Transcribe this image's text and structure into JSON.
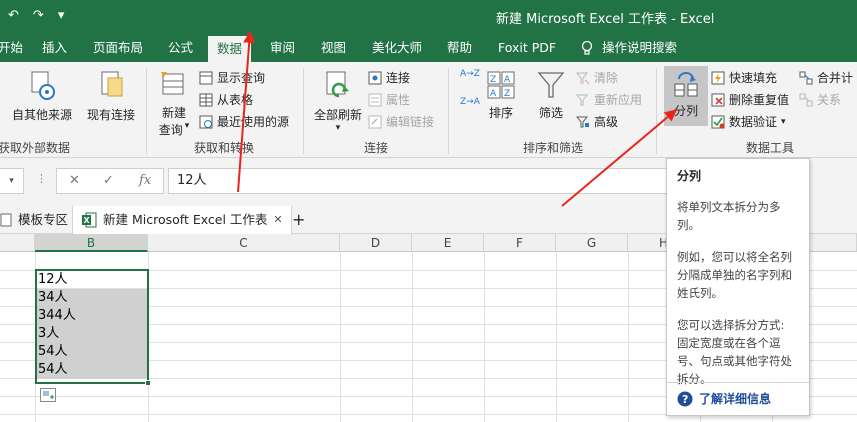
{
  "window": {
    "title": "新建 Microsoft Excel 工作表  -  Excel",
    "qat": [
      "↶",
      "↷",
      "▾"
    ]
  },
  "tabs": [
    "开始",
    "插入",
    "页面布局",
    "公式",
    "数据",
    "审阅",
    "视图",
    "美化大师",
    "帮助",
    "Foxit PDF",
    "操作说明搜索"
  ],
  "ribbon": {
    "get_external": {
      "label": "自其他来源",
      "group": "获取外部数据"
    },
    "existing": {
      "label": "现有连接"
    },
    "new_query": {
      "label_1": "新建",
      "label_2": "查询",
      "caret": "▾"
    },
    "show_query": "显示查询",
    "from_table": "从表格",
    "recent_sources": "最近使用的源",
    "group_get_transform": "获取和转换",
    "refresh_all": {
      "label": "全部刷新",
      "caret": "▾"
    },
    "connections": "连接",
    "properties": "属性",
    "edit_links": "编辑链接",
    "group_connections": "连接",
    "sort_asc": "A→Z",
    "sort_desc": "Z→A",
    "sort": "排序",
    "filter": "筛选",
    "clear": "清除",
    "reapply": "重新应用",
    "advanced": "高级",
    "group_sort_filter": "排序和筛选",
    "text_to_columns": "分列",
    "flash_fill": "快速填充",
    "remove_duplicates": "删除重复值",
    "data_validation": "数据验证",
    "validation_caret": "▾",
    "consolidate": "合并计",
    "relations": "关系",
    "group_data_tools": "数据工具"
  },
  "formula_bar": {
    "value": "12人",
    "cancel": "✕",
    "enter": "✓",
    "fx": "fx",
    "dots": "⋮",
    "caret": "▾"
  },
  "doc_tabs": [
    {
      "label": "模板专区"
    },
    {
      "label": "新建 Microsoft Excel 工作表",
      "close": "✕"
    }
  ],
  "add_tab": "+",
  "columns": [
    "B",
    "C",
    "D",
    "E",
    "F",
    "G",
    "H"
  ],
  "cells": [
    "12人",
    "34人",
    "344人",
    "3人",
    "54人",
    "54人"
  ],
  "tooltip": {
    "title": "分列",
    "p1": "将单列文本拆分为多列。",
    "p2": "例如，您可以将全名列分隔成单独的名字列和姓氏列。",
    "p3": "您可以选择拆分方式: 固定宽度或在各个逗号、句点或其他字符处拆分。",
    "link": "了解详细信息"
  },
  "colors": {
    "excel_green": "#217346",
    "arrow_red": "#e8261c"
  }
}
